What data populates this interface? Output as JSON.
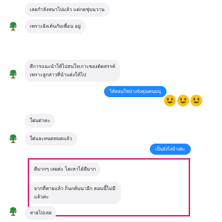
{
  "colors": {
    "incoming_bubble": "#f2f2f5",
    "outgoing_bubble": "#1e86ff",
    "highlight_border": "#d9226e",
    "text": "#1f1f1f"
  },
  "icons": {
    "avatar": "leaf-tree-avatar-icon",
    "emoji": "grinning-face-icon"
  },
  "messages": [
    {
      "sender": "partner",
      "lines": [
        "เลยกำลังหนาไปแล้ว แต่กดชุ่มนวาน"
      ]
    },
    {
      "sender": "partner",
      "lines": [
        "เพราะยังเค้นกับเพื่อน อยู่"
      ]
    },
    {
      "sender": "partner",
      "lines": [
        "ดีการแนะนำให้ไปสนใจเกาะของคิดสรรค์",
        "เพราะลูกสาวที่นำแต่งให้ไป"
      ]
    },
    {
      "sender": "me",
      "text": "ได้คอนโซปางจังคุณคนมนุ"
    },
    {
      "sender": "partner",
      "lines": [
        "ใฝนต่าคะ"
      ]
    },
    {
      "sender": "partner",
      "lines": [
        "ใฝนละหนดหมดแล้ว"
      ]
    },
    {
      "sender": "me",
      "text": "เป็นยังไงบ้างคะ"
    },
    {
      "sender": "partner",
      "lines": [
        "ดีมากๆ เลยค่ะ ไดเหาได้ดีมาก"
      ]
    },
    {
      "sender": "partner",
      "lines": [
        "จากที่หายแล้ว ก็นกต้นนาอีก ตอนนี้ไม่มี",
        "แล้วค่ะ"
      ]
    },
    {
      "sender": "partner",
      "lines": [
        "หายไปเลย"
      ]
    }
  ]
}
